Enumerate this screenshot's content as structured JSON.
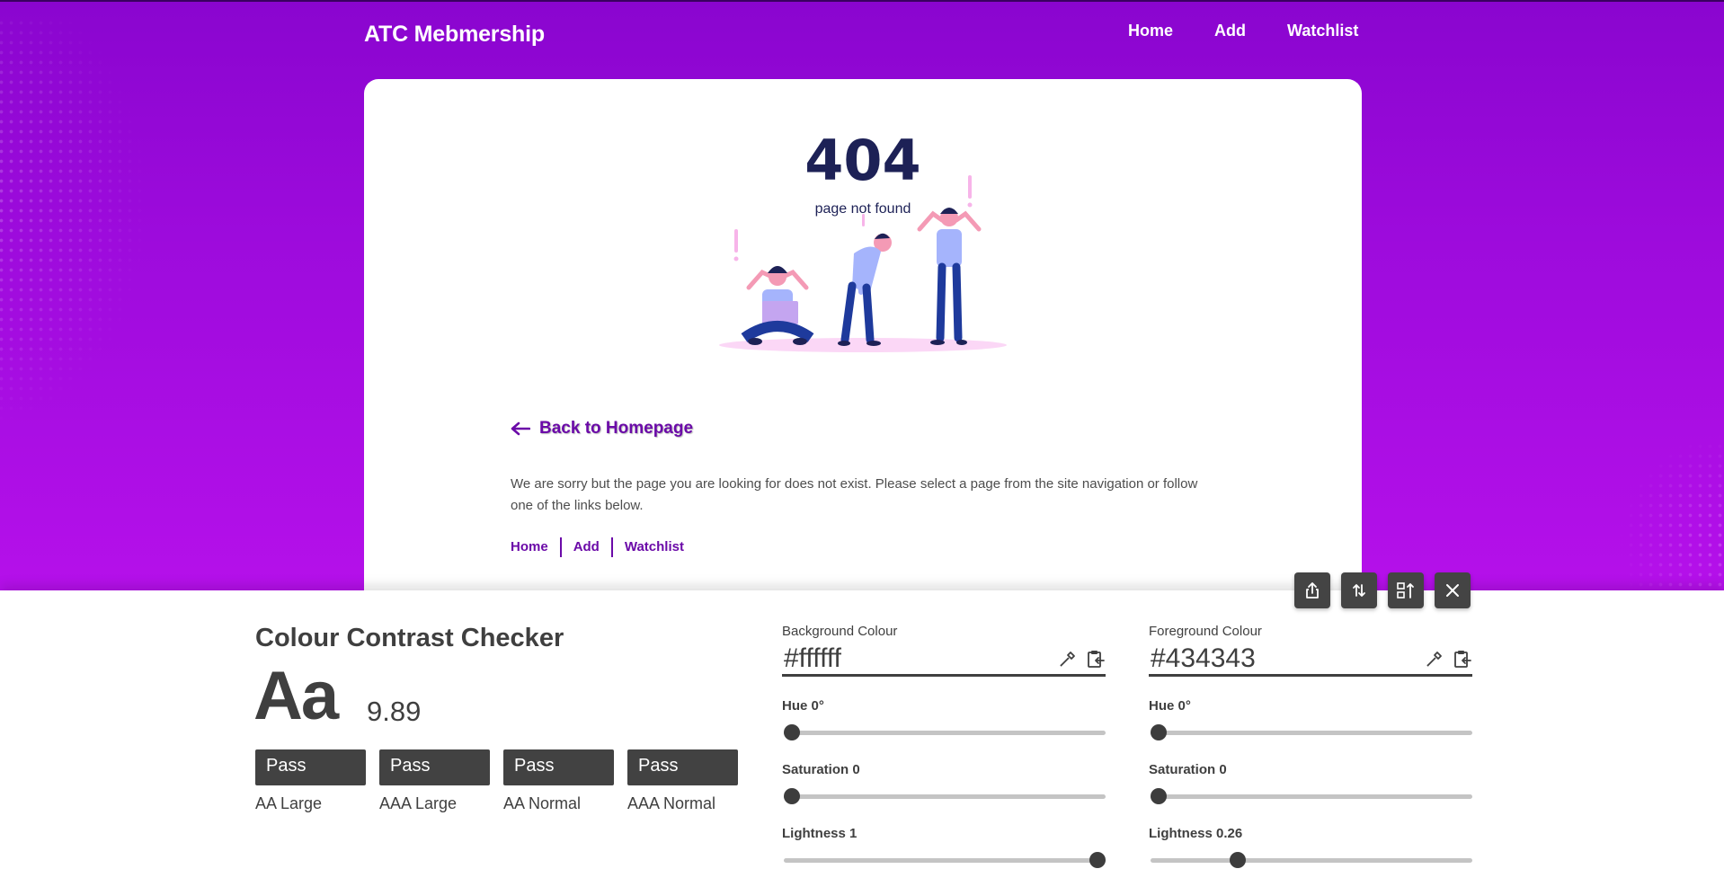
{
  "site": {
    "brand": "ATC Mebmership",
    "nav": [
      "Home",
      "Add",
      "Watchlist"
    ],
    "error_code": "404",
    "error_subtitle": "page not found",
    "back_link": "Back to Homepage",
    "message": "We are sorry but the page you are looking for does not exist. Please select a page from the site navigation or follow one of the links below.",
    "footer_links": [
      "Home",
      "Add",
      "Watchlist"
    ],
    "colors": {
      "accent": "#6b0aa8",
      "gradient_top": "#8a05cf",
      "gradient_bottom": "#b510ea"
    }
  },
  "checker": {
    "toolbar_icons": [
      "share-icon",
      "swap-icon",
      "layout-swap-icon",
      "close-icon"
    ],
    "title": "Colour Contrast Checker",
    "sample": "Aa",
    "ratio": "9.89",
    "results": [
      {
        "status": "Pass",
        "label": "AA Large"
      },
      {
        "status": "Pass",
        "label": "AAA Large"
      },
      {
        "status": "Pass",
        "label": "AA Normal"
      },
      {
        "status": "Pass",
        "label": "AAA Normal"
      }
    ],
    "background": {
      "label": "Background Colour",
      "hex": "#ffffff",
      "hue_label": "Hue 0°",
      "saturation_label": "Saturation 0",
      "lightness_label": "Lightness 1",
      "hue": 0,
      "saturation": 0,
      "lightness": 1
    },
    "foreground": {
      "label": "Foreground Colour",
      "hex": "#434343",
      "hue_label": "Hue 0°",
      "saturation_label": "Saturation 0",
      "lightness_label": "Lightness 0.26",
      "hue": 0,
      "saturation": 0,
      "lightness": 0.26
    }
  }
}
